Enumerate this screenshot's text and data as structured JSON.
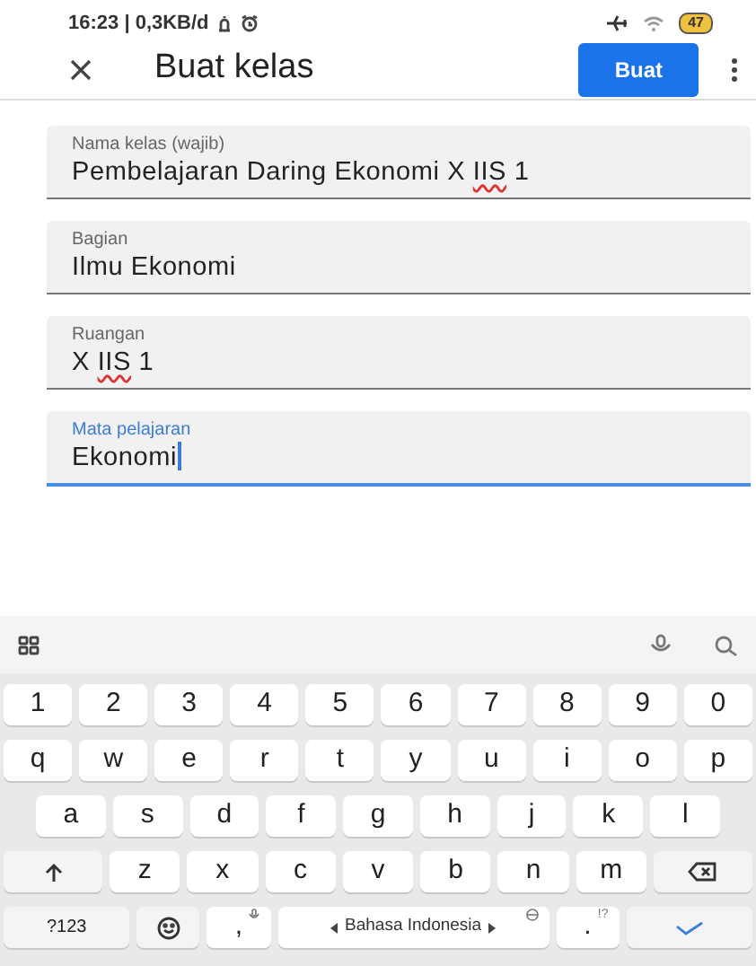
{
  "status_bar": {
    "time": "16:23 | 0,3KB/d",
    "battery": "47"
  },
  "app_bar": {
    "title": "Buat kelas",
    "action": "Buat"
  },
  "fields": [
    {
      "label": "Nama kelas (wajib)",
      "value_parts": [
        {
          "text": "Pembelajaran Daring Ekonomi X ",
          "misspelled": false
        },
        {
          "text": "IIS",
          "misspelled": true
        },
        {
          "text": " 1",
          "misspelled": false
        }
      ],
      "selected": false
    },
    {
      "label": "Bagian",
      "value_parts": [
        {
          "text": "Ilmu Ekonomi",
          "misspelled": false
        }
      ],
      "selected": false
    },
    {
      "label": "Ruangan",
      "value_parts": [
        {
          "text": "X ",
          "misspelled": false
        },
        {
          "text": "IIS",
          "misspelled": true
        },
        {
          "text": " 1",
          "misspelled": false
        }
      ],
      "selected": false
    },
    {
      "label": "Mata pelajaran",
      "value_parts": [
        {
          "text": "Ekonomi",
          "misspelled": false
        }
      ],
      "selected": true
    }
  ],
  "keyboard": {
    "rows": [
      {
        "keys": [
          {
            "kind": "char",
            "label": "1"
          },
          {
            "kind": "char",
            "label": "2"
          },
          {
            "kind": "char",
            "label": "3"
          },
          {
            "kind": "char",
            "label": "4"
          },
          {
            "kind": "char",
            "label": "5"
          },
          {
            "kind": "char",
            "label": "6"
          },
          {
            "kind": "char",
            "label": "7"
          },
          {
            "kind": "char",
            "label": "8"
          },
          {
            "kind": "char",
            "label": "9"
          },
          {
            "kind": "char",
            "label": "0"
          }
        ]
      },
      {
        "keys": [
          {
            "kind": "char",
            "label": "q"
          },
          {
            "kind": "char",
            "label": "w"
          },
          {
            "kind": "char",
            "label": "e"
          },
          {
            "kind": "char",
            "label": "r"
          },
          {
            "kind": "char",
            "label": "t"
          },
          {
            "kind": "char",
            "label": "y"
          },
          {
            "kind": "char",
            "label": "u"
          },
          {
            "kind": "char",
            "label": "i"
          },
          {
            "kind": "char",
            "label": "o"
          },
          {
            "kind": "char",
            "label": "p"
          }
        ]
      },
      {
        "keys": [
          {
            "kind": "char",
            "label": "a"
          },
          {
            "kind": "char",
            "label": "s"
          },
          {
            "kind": "char",
            "label": "d"
          },
          {
            "kind": "char",
            "label": "f"
          },
          {
            "kind": "char",
            "label": "g"
          },
          {
            "kind": "char",
            "label": "h"
          },
          {
            "kind": "char",
            "label": "j"
          },
          {
            "kind": "char",
            "label": "k"
          },
          {
            "kind": "char",
            "label": "l"
          }
        ]
      },
      {
        "keys": [
          {
            "kind": "shift"
          },
          {
            "kind": "char",
            "label": "z"
          },
          {
            "kind": "char",
            "label": "x"
          },
          {
            "kind": "char",
            "label": "c"
          },
          {
            "kind": "char",
            "label": "v"
          },
          {
            "kind": "char",
            "label": "b"
          },
          {
            "kind": "char",
            "label": "n"
          },
          {
            "kind": "char",
            "label": "m"
          },
          {
            "kind": "backspace"
          }
        ]
      },
      {
        "keys": [
          {
            "kind": "symbols",
            "label": "?123"
          },
          {
            "kind": "emoji"
          },
          {
            "kind": "comma",
            "label": ","
          },
          {
            "kind": "space",
            "label": "Bahasa Indonesia"
          },
          {
            "kind": "period",
            "label": ".",
            "hint": "!?"
          },
          {
            "kind": "enter"
          }
        ]
      }
    ]
  }
}
